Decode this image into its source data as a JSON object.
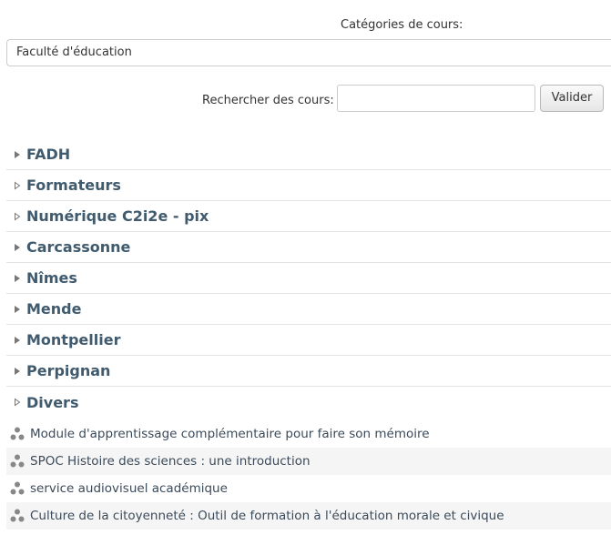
{
  "filter": {
    "label": "Catégories de cours:",
    "selected": "Faculté d'éducation"
  },
  "search": {
    "label": "Rechercher des cours:",
    "value": "",
    "button": "Valider"
  },
  "categories": [
    {
      "name": "FADH",
      "state": "collapsed-filled"
    },
    {
      "name": "Formateurs",
      "state": "collapsed-outline"
    },
    {
      "name": "Numérique C2i2e - pix",
      "state": "collapsed-outline"
    },
    {
      "name": "Carcassonne",
      "state": "collapsed-filled"
    },
    {
      "name": "Nîmes",
      "state": "collapsed-filled"
    },
    {
      "name": "Mende",
      "state": "collapsed-filled"
    },
    {
      "name": "Montpellier",
      "state": "collapsed-filled"
    },
    {
      "name": "Perpignan",
      "state": "collapsed-filled"
    },
    {
      "name": "Divers",
      "state": "collapsed-outline"
    }
  ],
  "courses": [
    {
      "name": "Module d'apprentissage complémentaire pour faire son mémoire"
    },
    {
      "name": "SPOC Histoire des sciences : une introduction"
    },
    {
      "name": "service audiovisuel académique"
    },
    {
      "name": "Culture de la citoyenneté : Outil de formation à l'éducation morale et civique"
    }
  ],
  "icons": {
    "course": "course-icon",
    "expand": "triangle-right-icon"
  },
  "colors": {
    "category_text": "#405a6e",
    "course_text": "#3b4a5a",
    "alt_row": "#f5f5f5"
  }
}
